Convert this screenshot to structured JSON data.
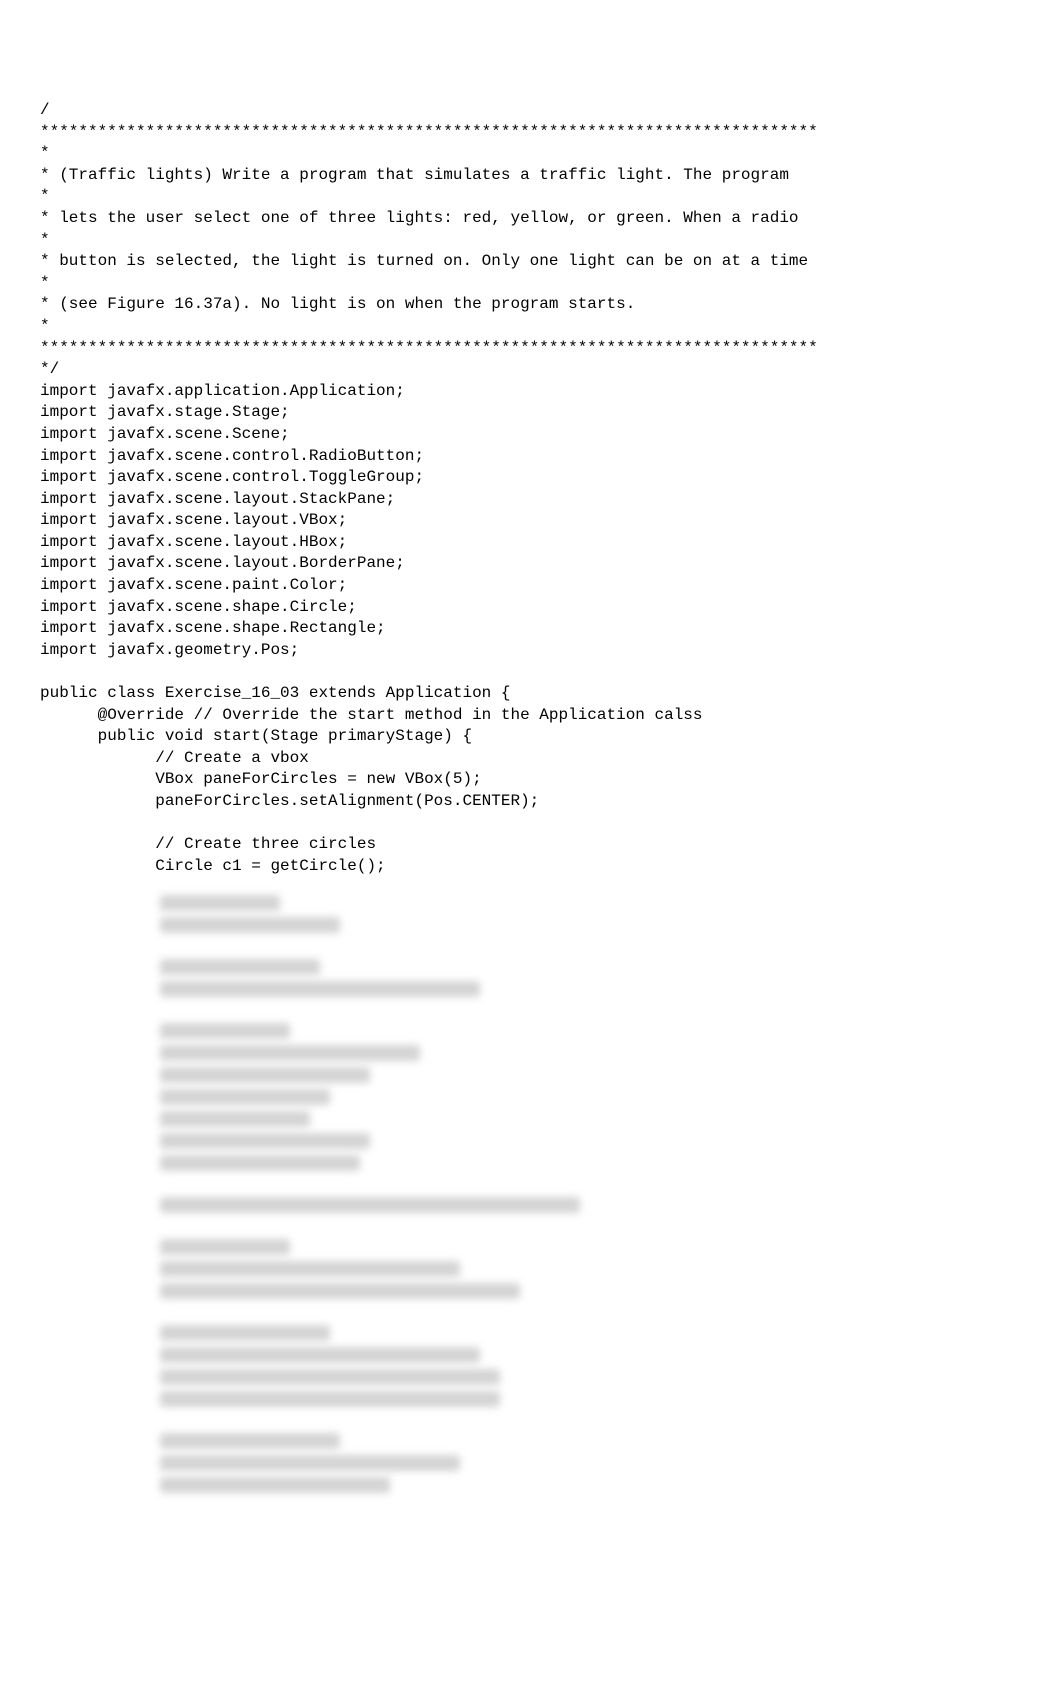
{
  "code": {
    "lines": [
      "/",
      "*********************************************************************************",
      "*",
      "* (Traffic lights) Write a program that simulates a traffic light. The program",
      "*",
      "* lets the user select one of three lights: red, yellow, or green. When a radio",
      "*",
      "* button is selected, the light is turned on. Only one light can be on at a time",
      "*",
      "* (see Figure 16.37a). No light is on when the program starts.",
      "*",
      "*********************************************************************************",
      "*/",
      "import javafx.application.Application;",
      "import javafx.stage.Stage;",
      "import javafx.scene.Scene;",
      "import javafx.scene.control.RadioButton;",
      "import javafx.scene.control.ToggleGroup;",
      "import javafx.scene.layout.StackPane;",
      "import javafx.scene.layout.VBox;",
      "import javafx.scene.layout.HBox;",
      "import javafx.scene.layout.BorderPane;",
      "import javafx.scene.paint.Color;",
      "import javafx.scene.shape.Circle;",
      "import javafx.scene.shape.Rectangle;",
      "import javafx.geometry.Pos;",
      "",
      "public class Exercise_16_03 extends Application {",
      "      @Override // Override the start method in the Application calss",
      "      public void start(Stage primaryStage) {",
      "            // Create a vbox",
      "            VBox paneForCircles = new VBox(5);",
      "            paneForCircles.setAlignment(Pos.CENTER);",
      "",
      "            // Create three circles",
      "            Circle c1 = getCircle();"
    ]
  },
  "blurred_groups": [
    [
      120,
      180
    ],
    [
      160,
      320
    ],
    [
      130,
      260,
      210,
      170,
      150,
      210,
      200
    ],
    [
      420
    ],
    [
      130,
      300,
      360
    ],
    [
      170,
      320,
      340,
      340
    ],
    [
      180,
      300,
      230
    ]
  ]
}
